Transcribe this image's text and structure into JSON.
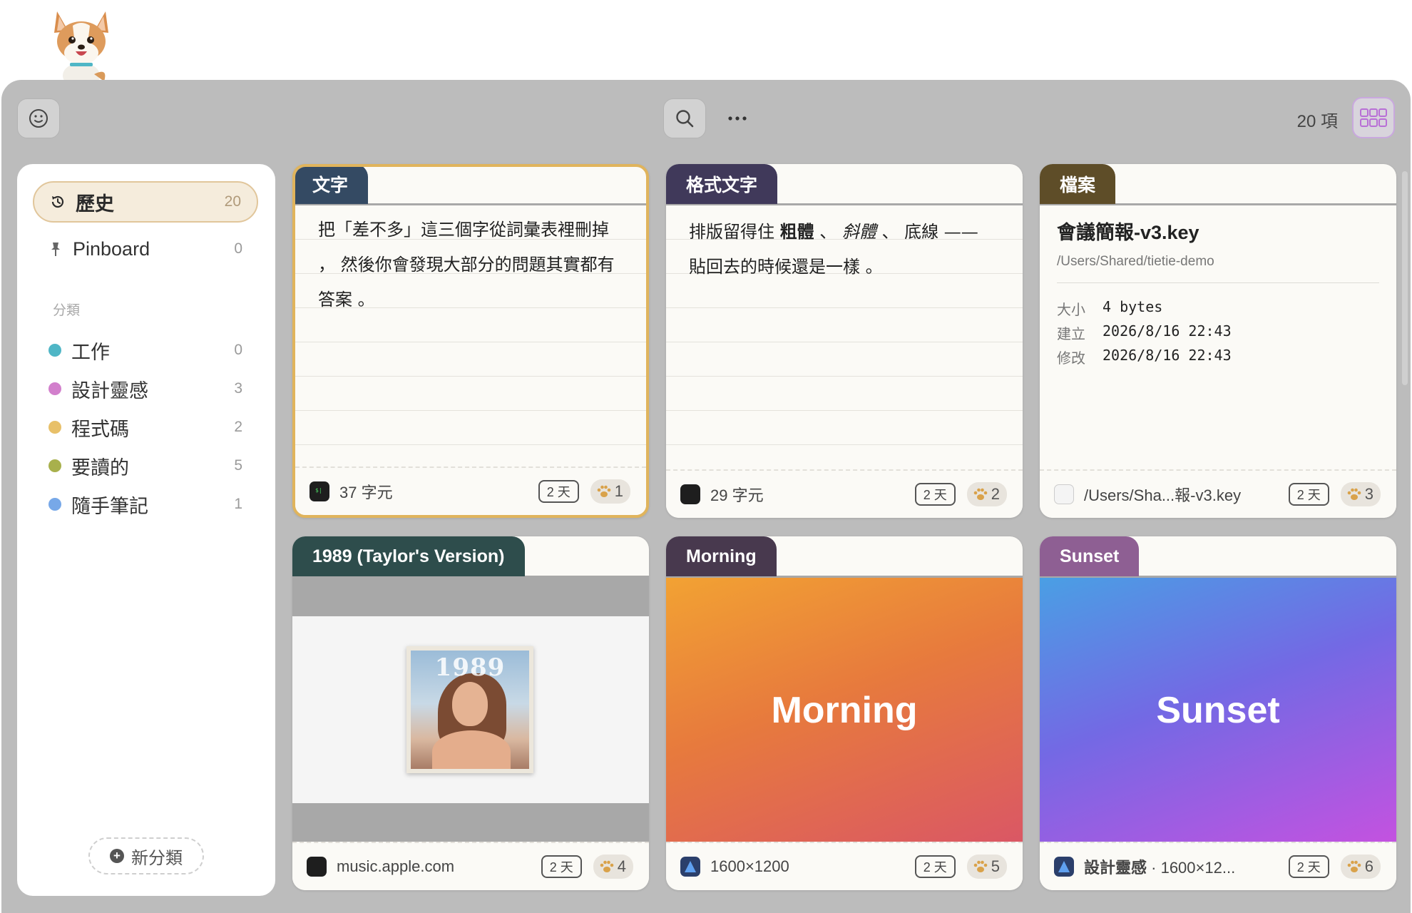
{
  "toolbar": {
    "item_count": "20 項"
  },
  "sidebar": {
    "items": [
      {
        "label": "歷史",
        "count": "20"
      },
      {
        "label": "Pinboard",
        "count": "0"
      }
    ],
    "section_title": "分類",
    "categories": [
      {
        "label": "工作",
        "count": "0",
        "color": "#4fb6c6"
      },
      {
        "label": "設計靈感",
        "count": "3",
        "color": "#d27fcc"
      },
      {
        "label": "程式碼",
        "count": "2",
        "color": "#e8c069"
      },
      {
        "label": "要讀的",
        "count": "5",
        "color": "#a8b04c"
      },
      {
        "label": "隨手筆記",
        "count": "1",
        "color": "#77a8e8"
      }
    ],
    "new_category": "新分類"
  },
  "cards": [
    {
      "tab": "文字",
      "tab_color": "#344a63",
      "text": "把「差不多」這三個字從詞彙表裡刪掉 ， 然後你會發現大部分的問題其實都有答案 。",
      "footer": "37 字元",
      "age": "2 天",
      "paw": "1"
    },
    {
      "tab": "格式文字",
      "tab_color": "#40395a",
      "text_parts": [
        "排版留得住 ",
        "粗體",
        " 、 ",
        "斜體",
        " 、 ",
        "底線",
        " —— 貼回去的時候還是一樣 。"
      ],
      "footer": "29 字元",
      "age": "2 天",
      "paw": "2"
    },
    {
      "tab": "檔案",
      "tab_color": "#5e4d28",
      "file_name": "會議簡報-v3.key",
      "file_path": "/Users/Shared/tietie-demo",
      "meta": [
        {
          "key": "大小",
          "value": "4 bytes"
        },
        {
          "key": "建立",
          "value": "2026/8/16 22:43"
        },
        {
          "key": "修改",
          "value": "2026/8/16 22:43"
        }
      ],
      "footer": "/Users/Sha...報-v3.key",
      "age": "2 天",
      "paw": "3"
    },
    {
      "tab": "1989 (Taylor's Version)",
      "tab_color": "#2e4d4c",
      "album_text": "1989",
      "footer": "music.apple.com",
      "age": "2 天",
      "paw": "4"
    },
    {
      "tab": "Morning",
      "tab_color": "#48394e",
      "image_text": "Morning",
      "footer": "1600×1200",
      "age": "2 天",
      "paw": "5"
    },
    {
      "tab": "Sunset",
      "tab_color": "#8e5f93",
      "image_text": "Sunset",
      "footer_category": "設計靈感",
      "footer": "· 1600×12...",
      "age": "2 天",
      "paw": "6"
    }
  ]
}
